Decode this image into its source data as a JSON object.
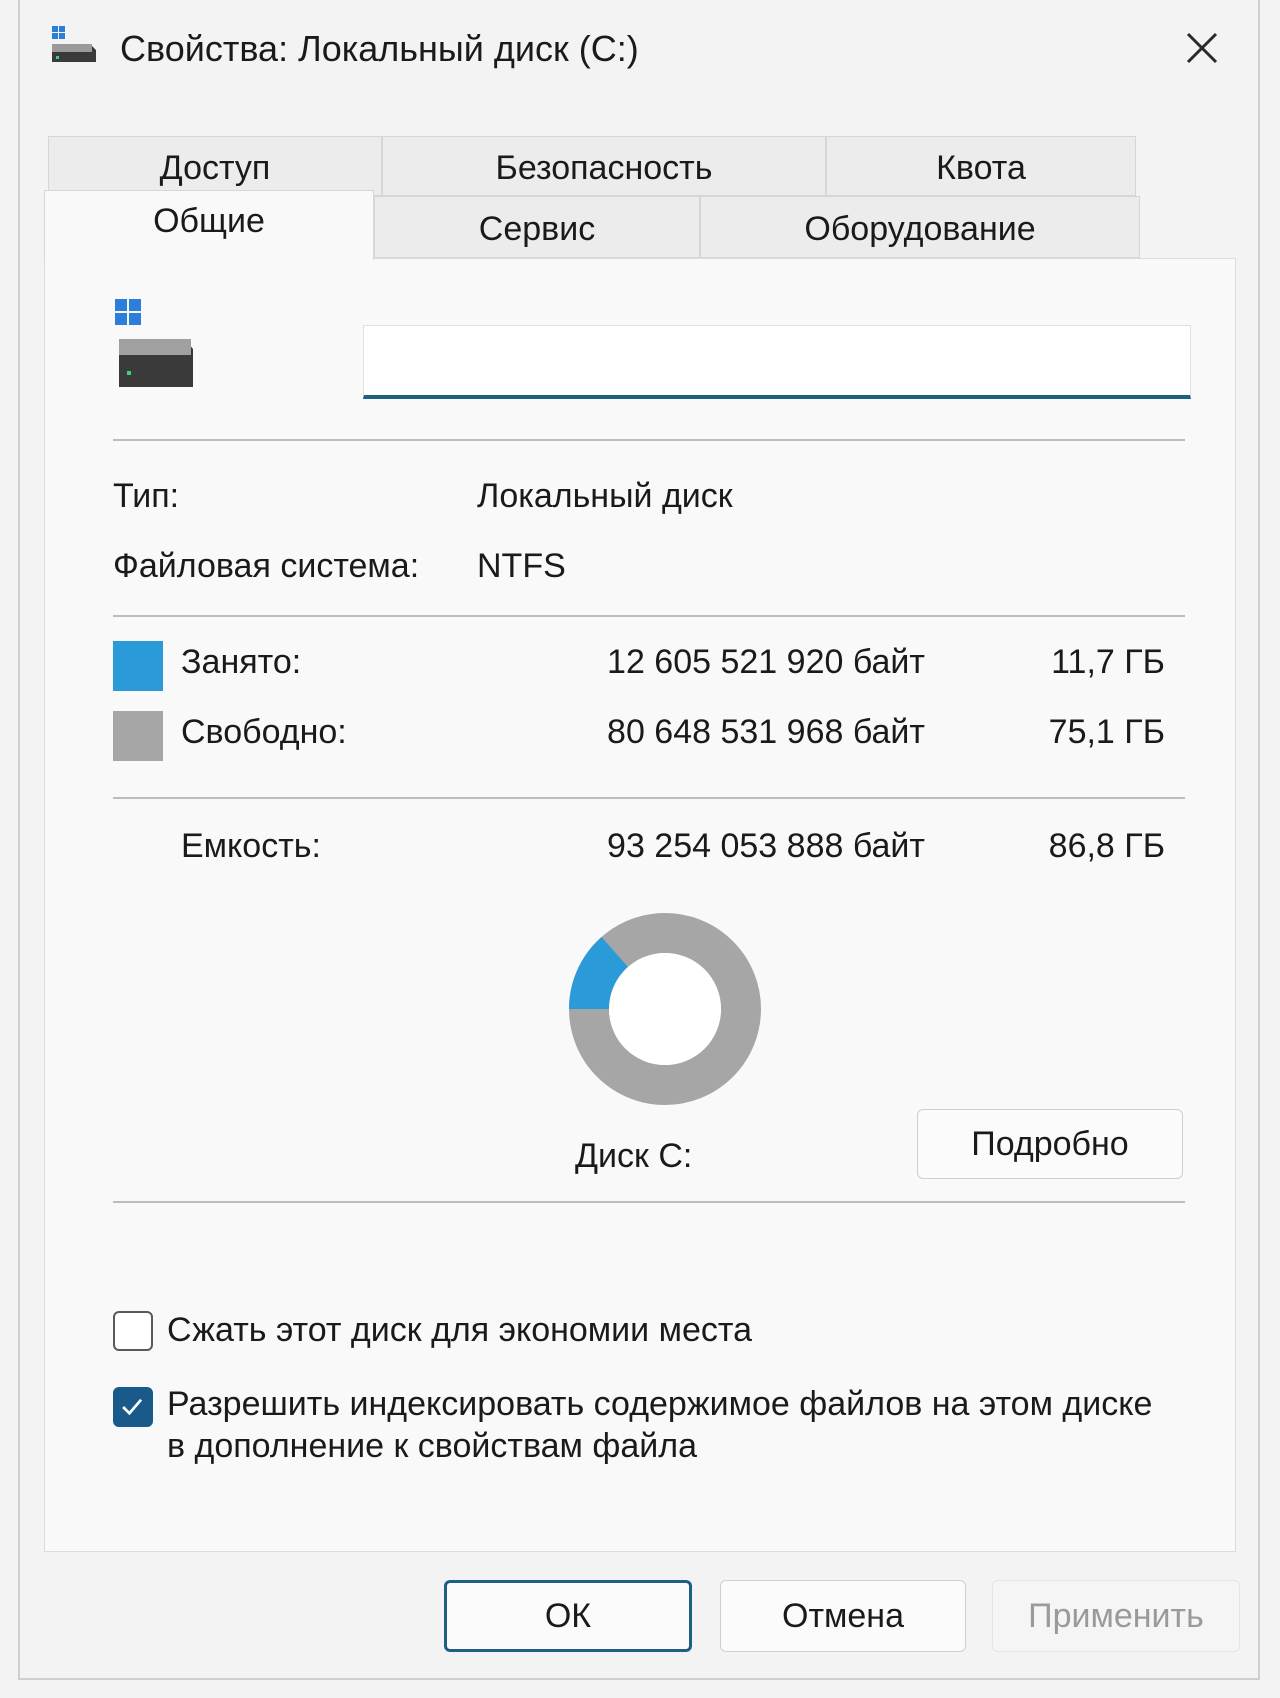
{
  "window": {
    "title": "Свойства: Локальный диск (C:)"
  },
  "tabs": {
    "row1": [
      "Доступ",
      "Безопасность",
      "Квота"
    ],
    "row2": [
      "Общие",
      "Сервис",
      "Оборудование"
    ],
    "active": "Общие"
  },
  "general": {
    "volume_name": {
      "value": "",
      "placeholder": ""
    },
    "type_label": "Тип:",
    "type_value": "Локальный диск",
    "fs_label": "Файловая система:",
    "fs_value": "NTFS",
    "used": {
      "label": "Занято:",
      "bytes": "12 605 521 920 байт",
      "size": "11,7 ГБ",
      "color": "#2a9ad8"
    },
    "free": {
      "label": "Свободно:",
      "bytes": "80 648 531 968 байт",
      "size": "75,1 ГБ",
      "color": "#a6a6a6"
    },
    "capacity": {
      "label": "Емкость:",
      "bytes": "93 254 053 888 байт",
      "size": "86,8 ГБ"
    },
    "used_fraction": 0.135,
    "disk_label": "Диск C:",
    "details_button": "Подробно",
    "compress_checkbox": {
      "label": "Сжать этот диск для экономии места",
      "checked": false
    },
    "index_checkbox": {
      "label": "Разрешить индексировать содержимое файлов на этом диске в дополнение к свойствам файла",
      "checked": true
    }
  },
  "buttons": {
    "ok": "ОК",
    "cancel": "Отмена",
    "apply": "Применить"
  }
}
